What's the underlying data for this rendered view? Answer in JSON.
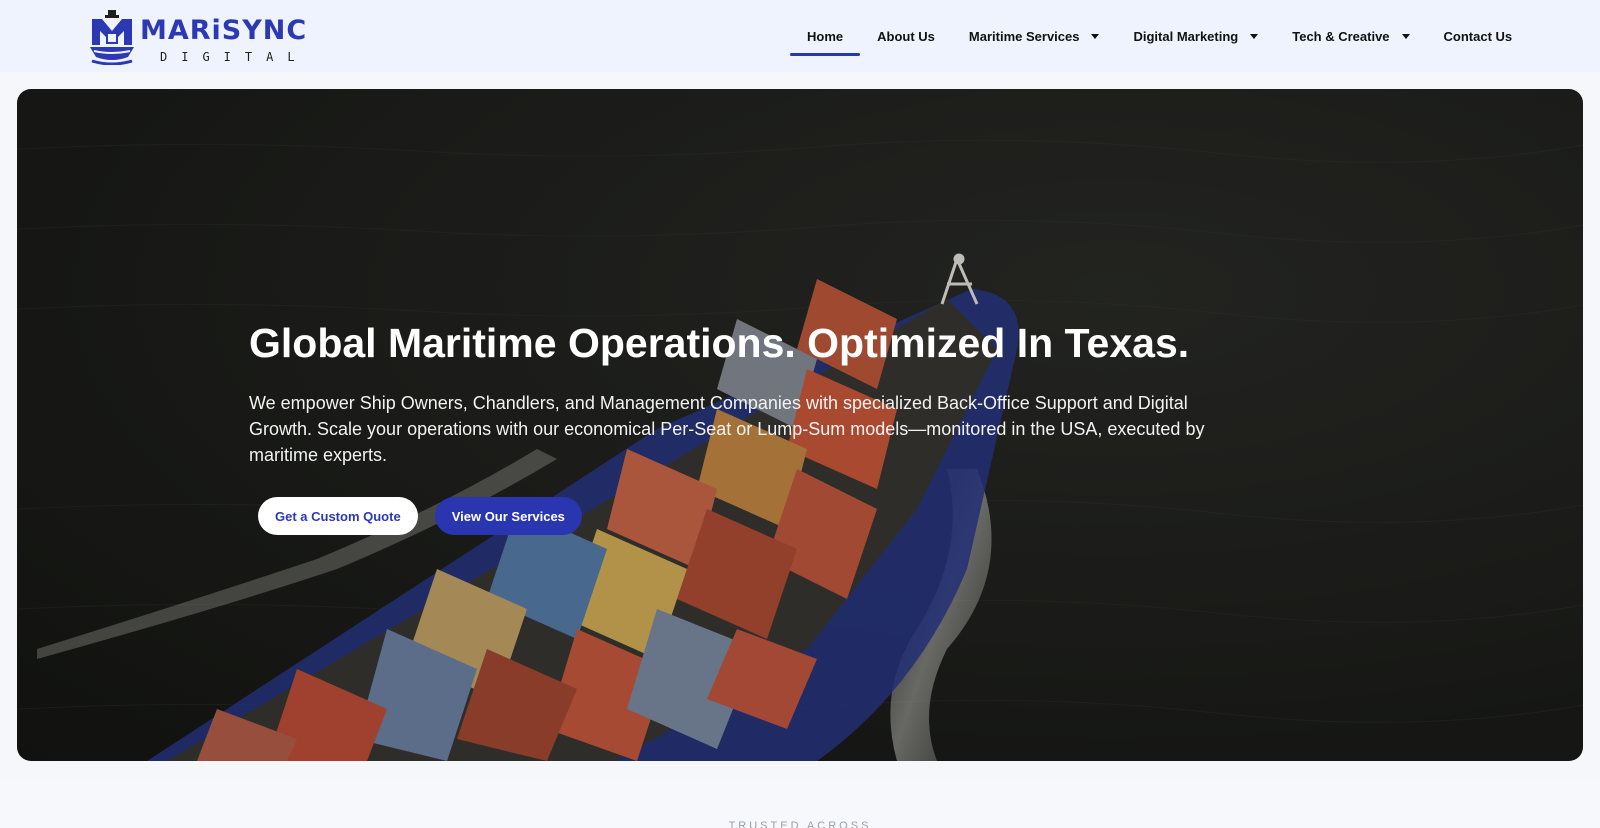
{
  "brand": {
    "name": "MARiSYNC",
    "tagline": "DIGITAL",
    "accent": "#2b39b5"
  },
  "nav": {
    "items": [
      {
        "label": "Home",
        "active": true,
        "dropdown": false
      },
      {
        "label": "About Us",
        "active": false,
        "dropdown": false
      },
      {
        "label": "Maritime Services",
        "active": false,
        "dropdown": true
      },
      {
        "label": "Digital Marketing",
        "active": false,
        "dropdown": true
      },
      {
        "label": "Tech & Creative",
        "active": false,
        "dropdown": true
      },
      {
        "label": "Contact Us",
        "active": false,
        "dropdown": false
      }
    ]
  },
  "hero": {
    "title": "Global Maritime Operations. Optimized In Texas.",
    "subtitle": "We empower Ship Owners, Chandlers, and Management Companies with specialized Back-Office Support and Digital Growth. Scale your operations with our economical Per-Seat or Lump-Sum models—monitored in the USA, executed by maritime experts.",
    "primary_cta": "View Our Services",
    "secondary_cta": "Get a Custom Quote",
    "background": "aerial-container-ship-image"
  },
  "section": {
    "eyebrow": "TRUSTED ACROSS"
  }
}
